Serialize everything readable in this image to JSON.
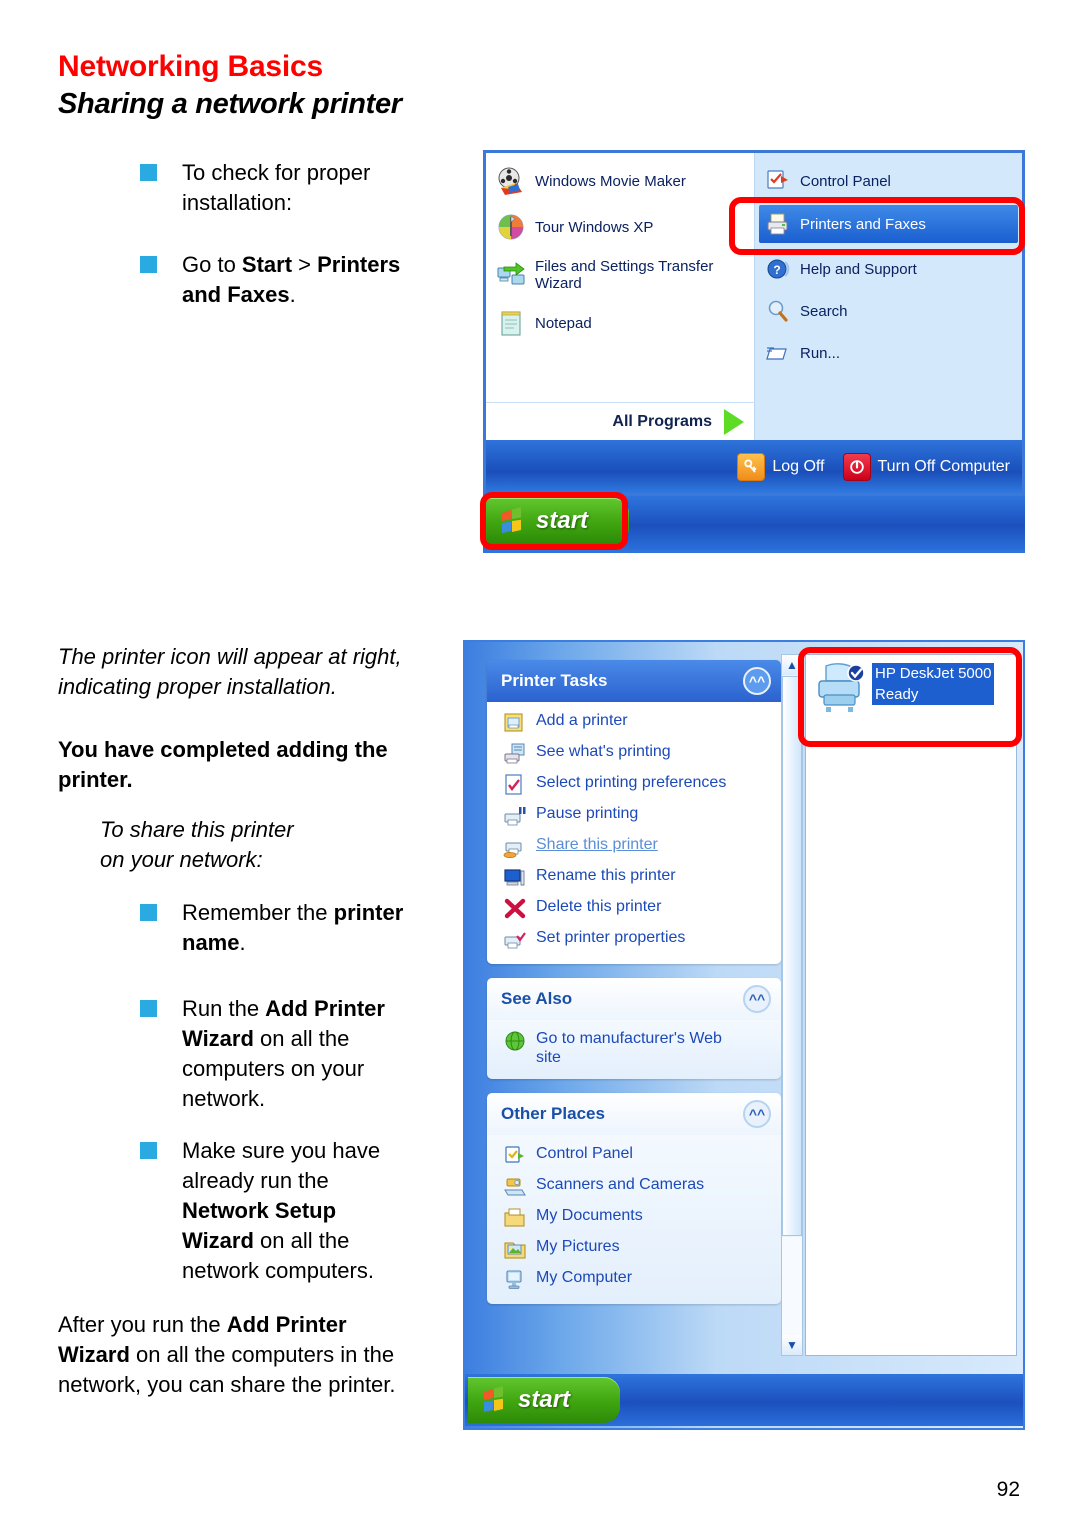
{
  "document": {
    "title": "Networking Basics",
    "subtitle": "Sharing a network printer",
    "page_number": "92"
  },
  "left_column": {
    "bullets_top": [
      {
        "text_plain": "To check for proper installation:"
      },
      {
        "text_plain": "Go to Start > Printers and Faxes."
      }
    ],
    "caption_italic": "The printer icon will appear at right, indicating proper installation.",
    "completed_heading": "You have completed adding the printer.",
    "share_intro": "To share this printer on your network:",
    "bullets_bottom": [
      {
        "text_plain": "Remember the printer name."
      },
      {
        "text_plain": "Run the Add Printer Wizard on all the computers on your network."
      },
      {
        "text_plain": "Make sure you have already run the Network Setup Wizard on all the network computers."
      }
    ],
    "closing_paragraph": "After you run the Add Printer Wizard on all the computers in the network, you can share the printer."
  },
  "start_menu": {
    "left_items": [
      {
        "label": "Windows Movie Maker",
        "icon": "film-reel-icon"
      },
      {
        "label": "Tour Windows XP",
        "icon": "globe-icon"
      },
      {
        "label": "Files and Settings Transfer Wizard",
        "icon": "transfer-icon"
      },
      {
        "label": "Notepad",
        "icon": "notepad-icon"
      }
    ],
    "all_programs": "All Programs",
    "right_items": [
      {
        "label": "Control Panel",
        "icon": "control-panel-icon",
        "selected": false
      },
      {
        "label": "Printers and Faxes",
        "icon": "printer-icon",
        "selected": true
      },
      {
        "label": "Help and Support",
        "icon": "help-icon",
        "selected": false
      },
      {
        "label": "Search",
        "icon": "search-icon",
        "selected": false
      },
      {
        "label": "Run...",
        "icon": "run-icon",
        "selected": false
      }
    ],
    "log_off": "Log Off",
    "turn_off": "Turn Off Computer",
    "start_button": "start"
  },
  "printers_window": {
    "printer_tasks": {
      "header": "Printer Tasks",
      "items": [
        {
          "label": "Add a printer",
          "icon": "add-printer-icon",
          "active": false
        },
        {
          "label": "See what's printing",
          "icon": "see-printing-icon",
          "active": false
        },
        {
          "label": "Select printing preferences",
          "icon": "printing-preferences-icon",
          "active": false
        },
        {
          "label": "Pause printing",
          "icon": "pause-printing-icon",
          "active": false
        },
        {
          "label": "Share this printer",
          "icon": "share-printer-icon",
          "active": true
        },
        {
          "label": "Rename this  printer",
          "icon": "rename-printer-icon",
          "active": false
        },
        {
          "label": "Delete this printer",
          "icon": "delete-printer-icon",
          "active": false
        },
        {
          "label": "Set printer properties",
          "icon": "printer-properties-icon",
          "active": false
        }
      ]
    },
    "see_also": {
      "header": "See Also",
      "items": [
        {
          "label": "Go to manufacturer's Web site",
          "icon": "web-globe-icon"
        }
      ]
    },
    "other_places": {
      "header": "Other Places",
      "items": [
        {
          "label": "Control Panel",
          "icon": "control-panel-icon"
        },
        {
          "label": "Scanners and Cameras",
          "icon": "scanner-icon"
        },
        {
          "label": "My Documents",
          "icon": "my-documents-icon"
        },
        {
          "label": "My Pictures",
          "icon": "my-pictures-icon"
        },
        {
          "label": "My Computer",
          "icon": "my-computer-icon"
        }
      ]
    },
    "printer_item": {
      "name": "HP DeskJet 5000",
      "status": "Ready",
      "icon": "printer-large-icon",
      "default_badge": "default-printer-check-icon"
    },
    "start_button": "start"
  },
  "colors": {
    "heading_red": "#ff0000",
    "bullet_blue": "#29abe2",
    "highlight_red": "#ff0000",
    "xp_blue": "#2e73db",
    "selection_blue": "#1e5fd0"
  }
}
